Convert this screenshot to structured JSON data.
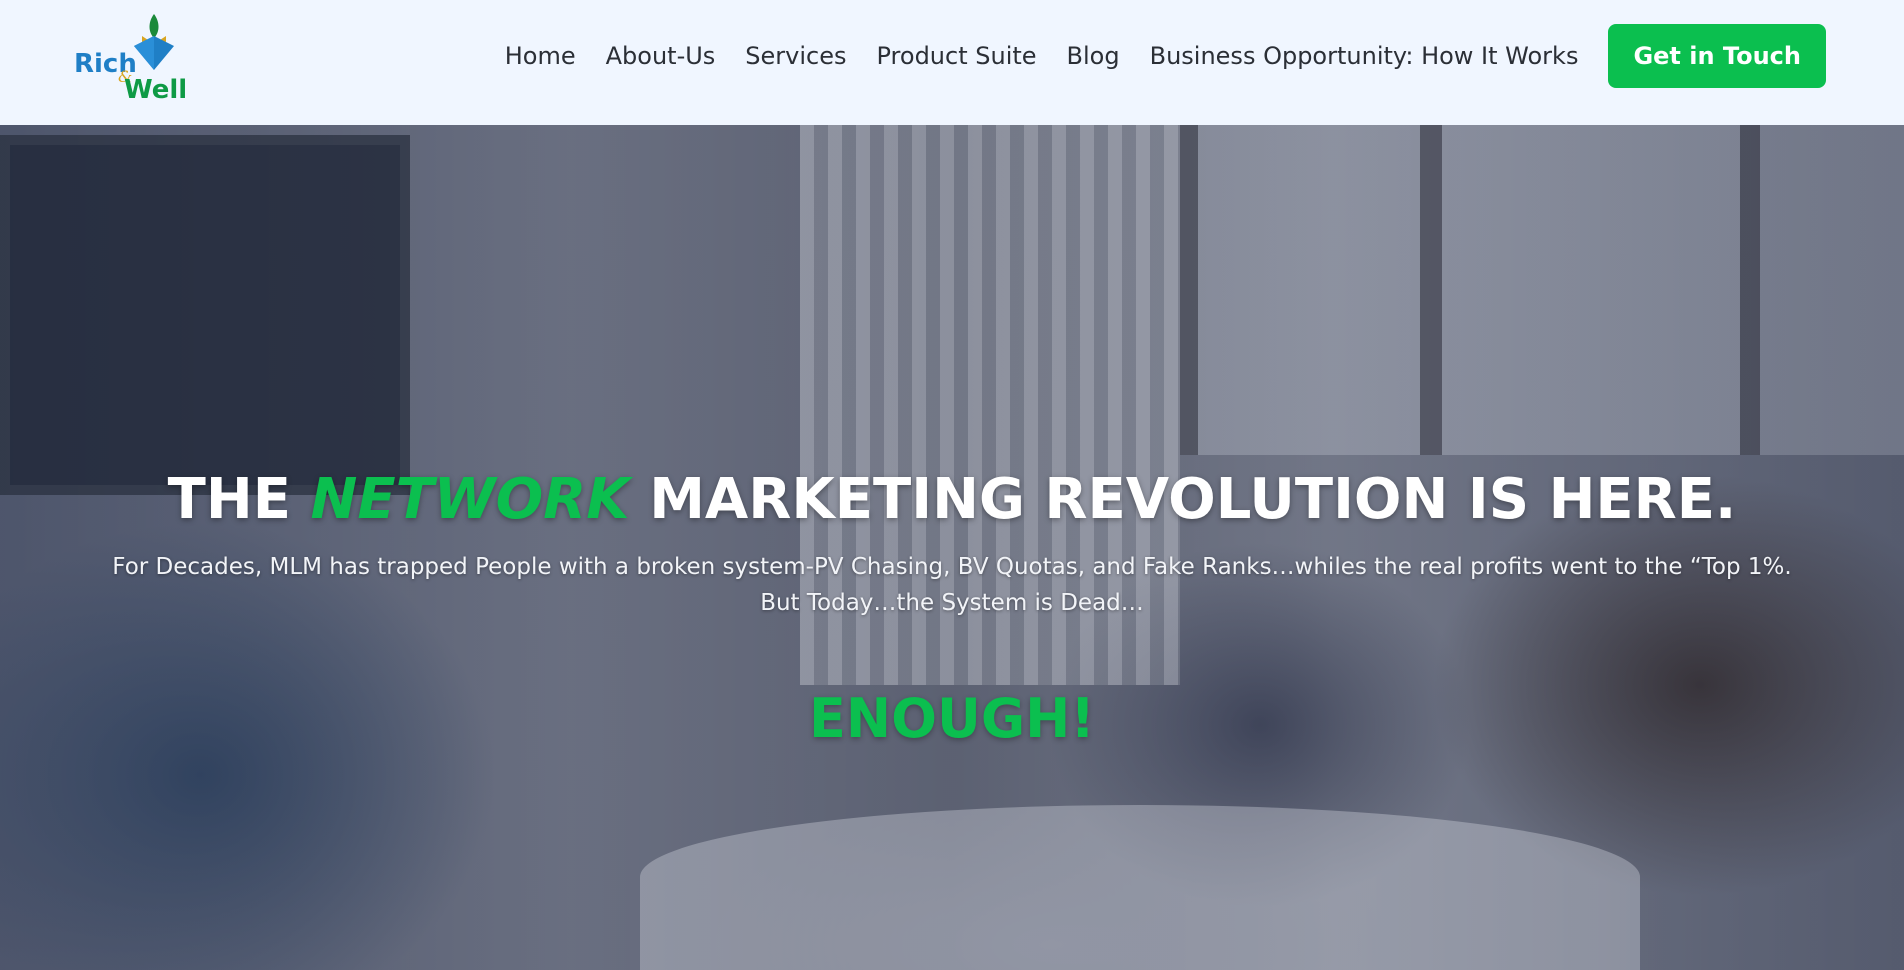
{
  "brand": {
    "logo_text_top": "Rich",
    "logo_text_amp": "&",
    "logo_text_bottom": "Well",
    "colors": {
      "blue": "#1f7fc6",
      "green": "#0bbf4f",
      "dark_green": "#1b8a3a"
    }
  },
  "nav": {
    "items": [
      {
        "label": "Home"
      },
      {
        "label": "About-Us"
      },
      {
        "label": "Services"
      },
      {
        "label": "Product Suite"
      },
      {
        "label": "Blog"
      },
      {
        "label": "Business Opportunity: How It Works"
      }
    ],
    "cta_label": "Get in Touch"
  },
  "hero": {
    "headline_part1": "THE ",
    "headline_accent": "NETWORK",
    "headline_part2": " MARKETING REVOLUTION IS HERE.",
    "subline1": "For Decades, MLM has trapped People with a broken system-PV Chasing, BV Quotas, and Fake Ranks…whiles the real profits went to the “Top 1%.",
    "subline2": "But Today…the System is Dead…",
    "emphasis": "ENOUGH!",
    "background_description": "team meeting around conference table",
    "accent_color": "#0bbf4f",
    "overlay_color": "#1c223a"
  }
}
